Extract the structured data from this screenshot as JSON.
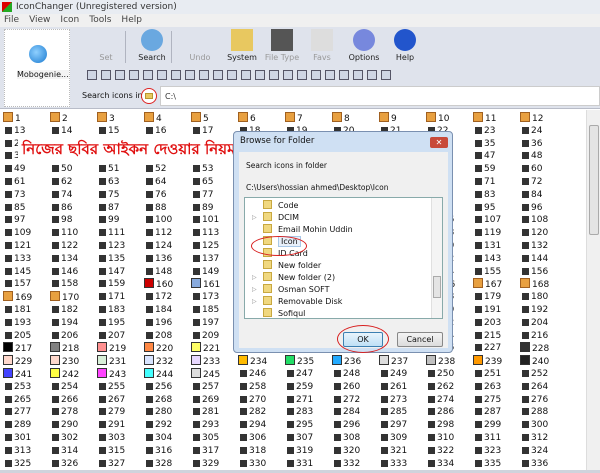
{
  "window": {
    "title": "IconChanger (Unregistered version)"
  },
  "menu": [
    "File",
    "View",
    "Icon",
    "Tools",
    "Help"
  ],
  "left_panel": {
    "label": "Mobogenie..."
  },
  "toolbar": [
    {
      "label": "Set",
      "icon": "set-icon",
      "enabled": false
    },
    {
      "label": "Search",
      "icon": "magnifier-icon",
      "enabled": true
    },
    {
      "label": "Undo",
      "icon": "undo-icon",
      "enabled": false
    },
    {
      "label": "System",
      "icon": "system-folder-icon",
      "enabled": true
    },
    {
      "label": "File Type",
      "icon": "file-type-icon",
      "enabled": false
    },
    {
      "label": "Favs",
      "icon": "star-icon",
      "enabled": false
    },
    {
      "label": "Options",
      "icon": "gear-icon",
      "enabled": true
    },
    {
      "label": "Help",
      "icon": "help-icon",
      "enabled": true
    }
  ],
  "search": {
    "label": "Search icons in",
    "value": "C:\\"
  },
  "overlay_text": "নিজের ছবির আইকন দেওয়ার নিয়মঃ",
  "grid": {
    "columns": 12,
    "first": 1,
    "last": 336,
    "swatches": {
      "217": "#000000",
      "218": "#808080",
      "219": "#ff9090",
      "220": "#ff8844",
      "221": "#ffff66",
      "225": "#cc33cc",
      "228": "#333333",
      "229": "#ffd8cc",
      "230": "#ffd8cc",
      "231": "#d8f0d8",
      "232": "#d8e4ff",
      "233": "#e8d8ff",
      "234": "#ffbb00",
      "235": "#22dd66",
      "236": "#22aaff",
      "237": "#dddddd",
      "238": "#c0c0c0",
      "239": "#ff9900",
      "240": "#222222",
      "241": "#4444ff",
      "242": "#ffff44",
      "243": "#ff44ff",
      "244": "#44ffff",
      "245": "#dddddd",
      "160": "#cc0000",
      "161": "#88aadd"
    }
  },
  "dialog": {
    "title": "Browse for Folder",
    "close": "✕",
    "message": "Search icons in folder",
    "path": "C:\\Users\\hossian ahmed\\Desktop\\Icon",
    "folders": [
      {
        "name": "Code",
        "expandable": false
      },
      {
        "name": "DCIM",
        "expandable": true
      },
      {
        "name": "Email Mohin Uddin",
        "expandable": false
      },
      {
        "name": "Icon",
        "expandable": false,
        "selected": true
      },
      {
        "name": "ID Card",
        "expandable": false
      },
      {
        "name": "New folder",
        "expandable": false
      },
      {
        "name": "New folder (2)",
        "expandable": true
      },
      {
        "name": "Osman SOFT",
        "expandable": true
      },
      {
        "name": "Removable Disk",
        "expandable": true
      },
      {
        "name": "Sofiqul",
        "expandable": false
      }
    ],
    "ok": "OK",
    "cancel": "Cancel"
  }
}
